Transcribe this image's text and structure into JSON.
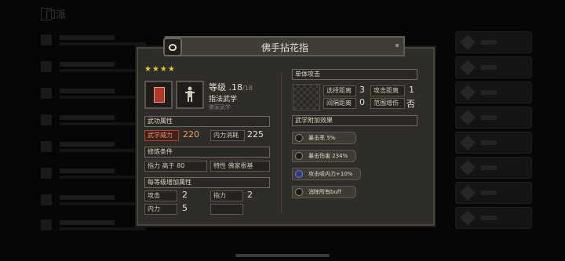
{
  "background": {
    "title": "门派"
  },
  "header": {
    "skill_name": "佛手拈花指",
    "stars": "★★★★"
  },
  "skill": {
    "level_label": "等级 .18",
    "level_max": "/18",
    "type": "指法武学",
    "sect": "佛家武学"
  },
  "attr_section": {
    "title": "武功属性"
  },
  "attributes": [
    {
      "label": "武学威力",
      "value": "220"
    },
    {
      "label": "内力消耗",
      "value": "225"
    }
  ],
  "train_section": {
    "title": "修炼条件"
  },
  "train_conditions": [
    {
      "label": "指力 高于 80"
    },
    {
      "label": "特性 佛家根基"
    }
  ],
  "level_bonus_section": {
    "title": "每等级增加属性"
  },
  "level_bonus": [
    {
      "label": "攻击",
      "value": "2"
    },
    {
      "label": "指力",
      "value": "2"
    },
    {
      "label": "内力",
      "value": "5"
    }
  ],
  "attack_section": {
    "title": "单体攻击"
  },
  "attack_stats": [
    {
      "label": "选择距离",
      "value": "3"
    },
    {
      "label": "攻击距离",
      "value": "1"
    },
    {
      "label": "间隔距离",
      "value": "0"
    },
    {
      "label": "范围增伤",
      "value": "否"
    }
  ],
  "effects_section": {
    "title": "武学附加效果"
  },
  "effects": [
    {
      "text": "暴击率 5%"
    },
    {
      "text": "暴击伤害 234%"
    },
    {
      "text": "攻击吸内力+10%"
    },
    {
      "text": "消除所有buff"
    }
  ],
  "colors": {
    "star": "#e6c233",
    "highlight": "#f08a6a",
    "panel": "#2f2d29"
  }
}
